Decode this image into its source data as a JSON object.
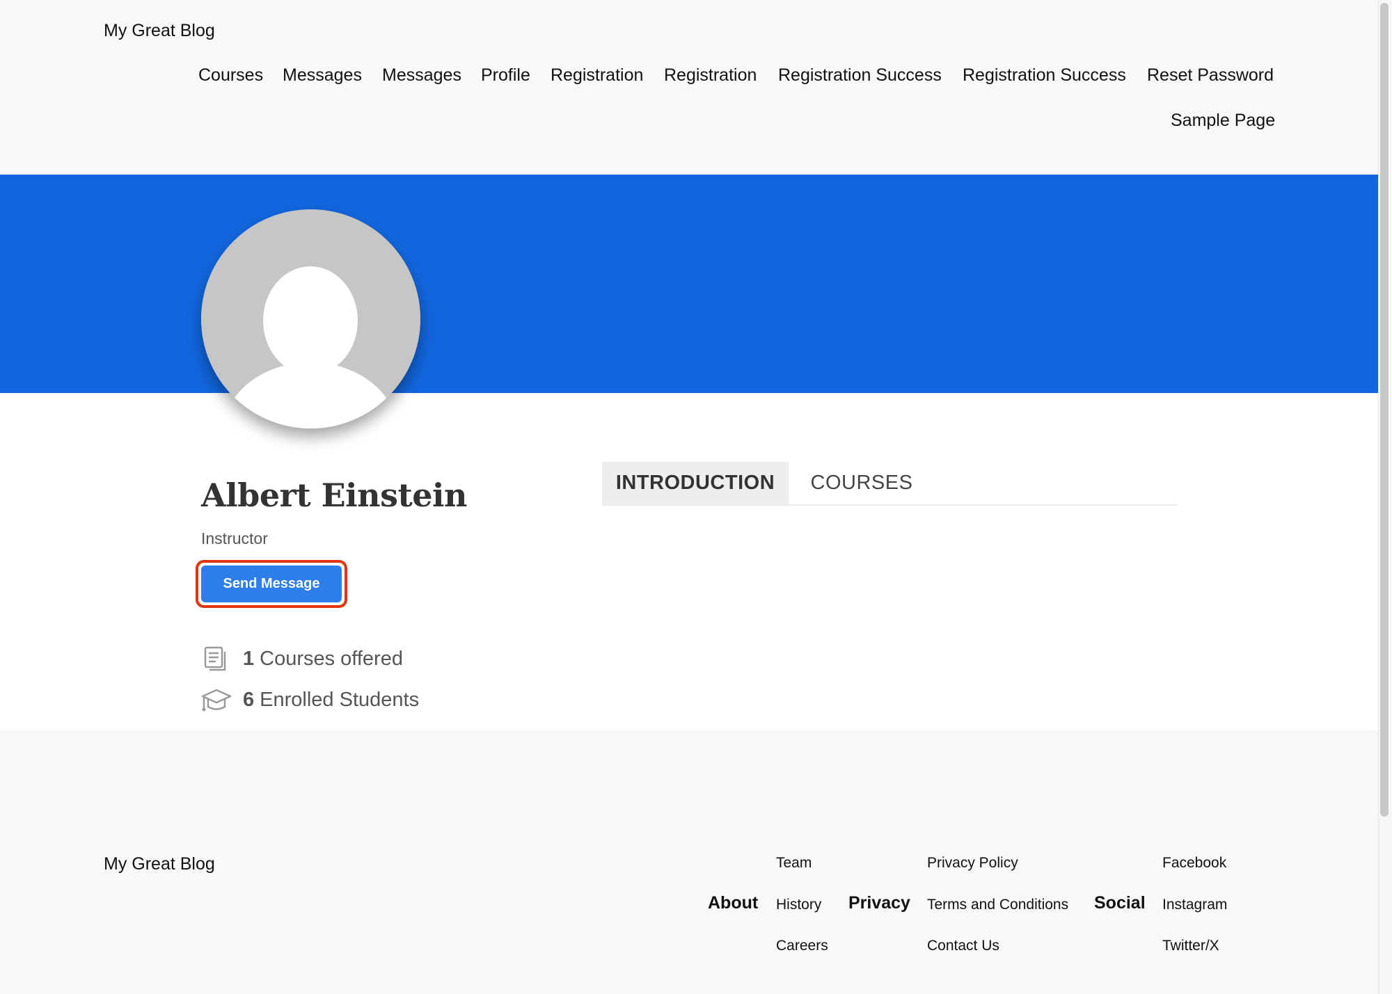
{
  "header": {
    "site_title": "My Great Blog",
    "nav": [
      "Courses",
      "Messages",
      "Messages",
      "Profile",
      "Registration",
      "Registration",
      "Registration Success",
      "Registration Success",
      "Reset Password",
      "Sample Page"
    ]
  },
  "colors": {
    "banner": "#1266de",
    "button": "#2d7ee8",
    "highlight_border": "#e2350b"
  },
  "profile": {
    "avatar_icon": "user-placeholder-icon",
    "name": "Albert Einstein",
    "role": "Instructor",
    "send_message_label": "Send Message",
    "stats": {
      "courses_count": "1",
      "courses_label": "Courses offered",
      "courses_icon": "document-icon",
      "students_count": "6",
      "students_label": "Enrolled Students",
      "students_icon": "graduation-cap-icon"
    }
  },
  "tabs": {
    "introduction": "INTRODUCTION",
    "courses": "COURSES",
    "active": "introduction"
  },
  "footer": {
    "site_title": "My Great Blog",
    "columns": [
      {
        "heading": "About",
        "links": [
          "Team",
          "History",
          "Careers"
        ]
      },
      {
        "heading": "Privacy",
        "links": [
          "Privacy Policy",
          "Terms and Conditions",
          "Contact Us"
        ]
      },
      {
        "heading": "Social",
        "links": [
          "Facebook",
          "Instagram",
          "Twitter/X"
        ]
      }
    ]
  }
}
